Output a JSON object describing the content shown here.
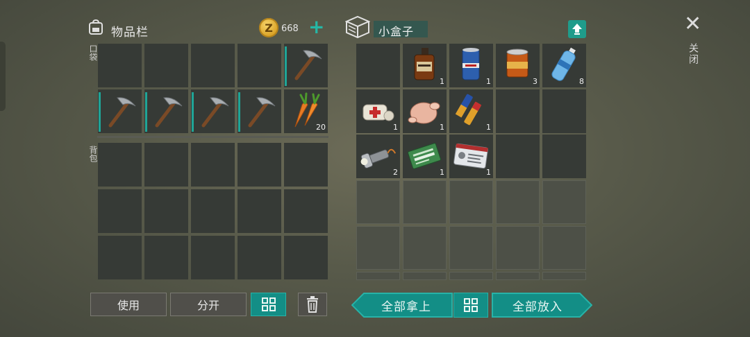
{
  "inventory": {
    "title": "物品栏",
    "coins": "668",
    "coin_symbol": "Z",
    "add_label": "+",
    "pocket_label": "口袋",
    "backpack_label": "背包",
    "pocket_items": [
      "",
      "",
      "",
      "",
      "pickaxe",
      "pickaxe",
      "pickaxe",
      "pickaxe",
      "pickaxe",
      "carrots"
    ],
    "carrot_qty": "20"
  },
  "container": {
    "name": "小盒子",
    "items": [
      {
        "icon": "empty",
        "qty": ""
      },
      {
        "icon": "whiskey-icon",
        "qty": "1"
      },
      {
        "icon": "beer-can-icon",
        "qty": "1"
      },
      {
        "icon": "food-can-icon",
        "qty": "3"
      },
      {
        "icon": "water-bottle-icon",
        "qty": "8"
      },
      {
        "icon": "bandage-icon",
        "qty": "1"
      },
      {
        "icon": "chicken-icon",
        "qty": "1"
      },
      {
        "icon": "batteries-icon",
        "qty": "1"
      },
      {
        "icon": "flashlight-icon",
        "qty": "2"
      },
      {
        "icon": "ration-coupon-icon",
        "qty": "1"
      },
      {
        "icon": "id-card-icon",
        "qty": "1"
      }
    ]
  },
  "buttons": {
    "use": "使用",
    "split": "分开",
    "take_all": "全部拿上",
    "put_all": "全部放入"
  },
  "close": {
    "label": "关闭",
    "x": "✕"
  },
  "colors": {
    "accent": "#138e86",
    "slot": "#363a36"
  }
}
